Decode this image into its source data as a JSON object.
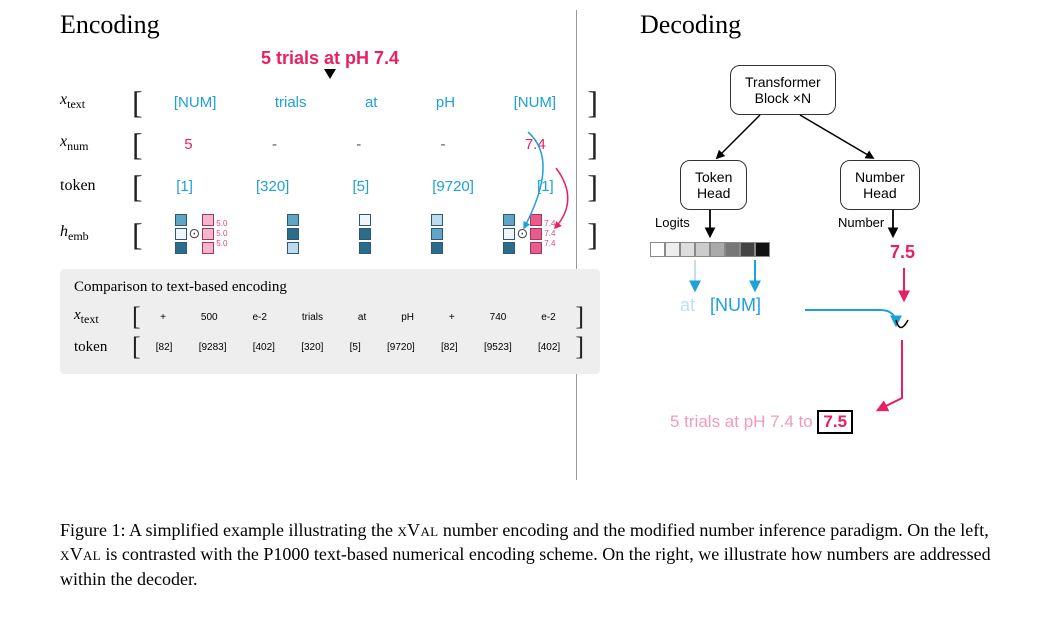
{
  "encoding": {
    "heading": "Encoding",
    "headline": "5 trials at pH 7.4",
    "row_labels": {
      "xtext_var": "x",
      "xtext_sub": "text",
      "xnum_var": "x",
      "xnum_sub": "num",
      "token": "token",
      "hemb_var": "h",
      "hemb_sub": "emb"
    },
    "xtext": [
      "[NUM]",
      "trials",
      "at",
      "pH",
      "[NUM]"
    ],
    "xnum": [
      "5",
      "-",
      "-",
      "-",
      "7.4"
    ],
    "tokens": [
      "[1]",
      "[320]",
      "[5]",
      "[9720]",
      "[1]"
    ],
    "odot": "⊙",
    "emb_tiny_left": [
      "5.0",
      "5.0",
      "5.0"
    ],
    "emb_tiny_right": [
      "7.4",
      "7.4",
      "7.4"
    ],
    "comparison": {
      "title": "Comparison to text-based encoding",
      "xtext": [
        "+",
        "500",
        "e-2",
        "trials",
        "at",
        "pH",
        "+",
        "740",
        "e-2"
      ],
      "tokens": [
        "[82]",
        "[9283]",
        "[402]",
        "[320]",
        "[5]",
        "[9720]",
        "[82]",
        "[9523]",
        "[402]"
      ]
    }
  },
  "decoding": {
    "heading": "Decoding",
    "transformer_l1": "Transformer",
    "transformer_l2": "Block ×N",
    "token_head_l1": "Token",
    "token_head_l2": "Head",
    "number_head_l1": "Number",
    "number_head_l2": "Head",
    "logits_label": "Logits",
    "number_label": "Number",
    "number_value": "7.5",
    "word_at": "at",
    "word_num": "[NUM]",
    "final_prefix": "5 trials at pH 7.4 to ",
    "final_box": "7.5"
  },
  "caption": {
    "prefix": "Figure 1: A simplified example illustrating the ",
    "xval": "xVal",
    "mid1": " number encoding and the modified number inference paradigm. On the left, ",
    "mid2": " is contrasted with the P1000 text-based numerical encoding scheme. On the right, we illustrate how numbers are addressed within the decoder."
  }
}
